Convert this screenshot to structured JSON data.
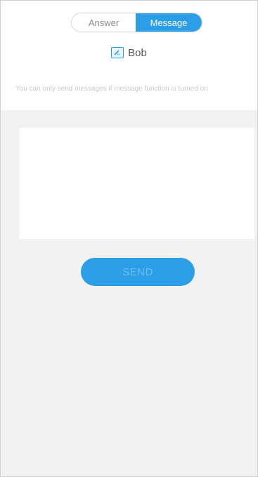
{
  "tabs": {
    "answer_label": "Answer",
    "message_label": "Message",
    "active": "Message"
  },
  "recipient": {
    "icon": "edit-icon",
    "name": "Bob"
  },
  "notice": {
    "text": "You can only send messages if message function is turned on"
  },
  "message": {
    "value": "",
    "placeholder": ""
  },
  "send_button": {
    "label": "SEND"
  },
  "colors": {
    "accent": "#2c9ee8",
    "background": "#f2f2f2",
    "panel": "#ffffff"
  }
}
